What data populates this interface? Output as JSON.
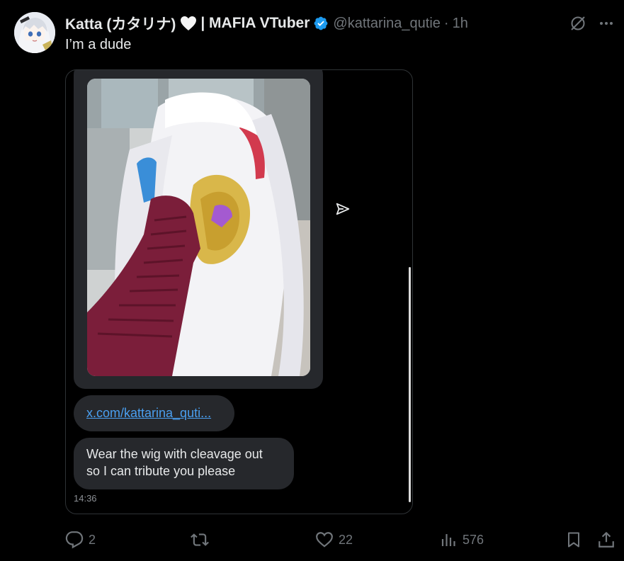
{
  "tweet": {
    "display_name": "Katta (カタリナ)",
    "name_suffix": "| MAFIA VTuber",
    "handle": "@kattarina_qutie",
    "separator": "·",
    "time": "1h",
    "text": "I’m a dude"
  },
  "dm_screenshot": {
    "link_text": "x.com/kattarina_quti...",
    "message_lines": [
      "Wear the wig with cleavage out",
      "so I can tribute you please"
    ],
    "message_time": "14:36"
  },
  "actions": {
    "replies": "2",
    "reposts": "",
    "likes": "22",
    "views": "576"
  },
  "icons": {
    "grok": "grok-icon",
    "more": "more-icon",
    "reply": "reply-icon",
    "repost": "repost-icon",
    "like": "heart-icon",
    "views": "views-icon",
    "bookmark": "bookmark-icon",
    "share": "share-icon",
    "verified": "verified-badge-icon",
    "send": "send-icon"
  },
  "colors": {
    "background": "#000000",
    "text_primary": "#e7e9ea",
    "text_secondary": "#71767b",
    "verified_blue": "#1d9bf0",
    "link_blue": "#4a9ff0",
    "bubble": "#26282c"
  }
}
